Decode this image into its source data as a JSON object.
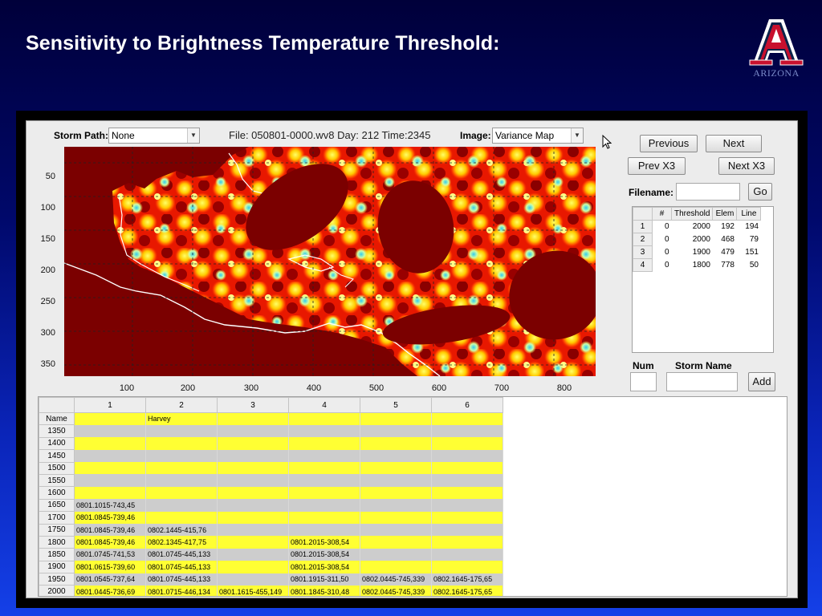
{
  "slide": {
    "title": "Sensitivity to Brightness Temperature Threshold:",
    "logo_text": "ARIZONA"
  },
  "toolbar": {
    "storm_path_label": "Storm Path:",
    "storm_path_value": "None",
    "file_info": "File: 050801-0000.wv8  Day: 212  Time:2345",
    "image_label": "Image:",
    "image_value": "Variance Map"
  },
  "nav": {
    "previous": "Previous",
    "next": "Next",
    "prev_x3": "Prev X3",
    "next_x3": "Next X3",
    "filename_label": "Filename:",
    "filename_value": "",
    "go": "Go"
  },
  "plot": {
    "y_ticks": [
      "50",
      "100",
      "150",
      "200",
      "250",
      "300",
      "350"
    ],
    "x_ticks": [
      "100",
      "200",
      "300",
      "400",
      "500",
      "600",
      "700",
      "800"
    ]
  },
  "threshold_table": {
    "headers": [
      "#",
      "Threshold",
      "Elem",
      "Line"
    ],
    "rows": [
      {
        "row": "1",
        "num": "0",
        "threshold": "2000",
        "elem": "192",
        "line": "194"
      },
      {
        "row": "2",
        "num": "0",
        "threshold": "2000",
        "elem": "468",
        "line": "79"
      },
      {
        "row": "3",
        "num": "0",
        "threshold": "1900",
        "elem": "479",
        "line": "151"
      },
      {
        "row": "4",
        "num": "0",
        "threshold": "1800",
        "elem": "778",
        "line": "50"
      }
    ]
  },
  "add_form": {
    "num_label": "Num",
    "storm_name_label": "Storm Name",
    "add": "Add"
  },
  "storm_grid": {
    "columns": [
      "1",
      "2",
      "3",
      "4",
      "5",
      "6"
    ],
    "rows": [
      {
        "label": "Name",
        "cells": [
          "",
          "Harvey",
          "",
          "",
          "",
          ""
        ]
      },
      {
        "label": "1350",
        "cells": [
          "",
          "",
          "",
          "",
          "",
          ""
        ]
      },
      {
        "label": "1400",
        "cells": [
          "",
          "",
          "",
          "",
          "",
          ""
        ]
      },
      {
        "label": "1450",
        "cells": [
          "",
          "",
          "",
          "",
          "",
          ""
        ]
      },
      {
        "label": "1500",
        "cells": [
          "",
          "",
          "",
          "",
          "",
          ""
        ]
      },
      {
        "label": "1550",
        "cells": [
          "",
          "",
          "",
          "",
          "",
          ""
        ]
      },
      {
        "label": "1600",
        "cells": [
          "",
          "",
          "",
          "",
          "",
          ""
        ]
      },
      {
        "label": "1650",
        "cells": [
          "0801.1015-743,45",
          "",
          "",
          "",
          "",
          ""
        ]
      },
      {
        "label": "1700",
        "cells": [
          "0801.0845-739,46",
          "",
          "",
          "",
          "",
          ""
        ]
      },
      {
        "label": "1750",
        "cells": [
          "0801.0845-739,46",
          "0802.1445-415,76",
          "",
          "",
          "",
          ""
        ]
      },
      {
        "label": "1800",
        "cells": [
          "0801.0845-739,46",
          "0802.1345-417,75",
          "",
          "0801.2015-308,54",
          "",
          ""
        ]
      },
      {
        "label": "1850",
        "cells": [
          "0801.0745-741,53",
          "0801.0745-445,133",
          "",
          "0801.2015-308,54",
          "",
          ""
        ]
      },
      {
        "label": "1900",
        "cells": [
          "0801.0615-739,60",
          "0801.0745-445,133",
          "",
          "0801.2015-308,54",
          "",
          ""
        ]
      },
      {
        "label": "1950",
        "cells": [
          "0801.0545-737,64",
          "0801.0745-445,133",
          "",
          "0801.1915-311,50",
          "0802.0445-745,339",
          "0802.1645-175,65"
        ]
      },
      {
        "label": "2000",
        "cells": [
          "0801.0445-736,69",
          "0801.0715-446,134",
          "0801.1615-455,149",
          "0801.1845-310,48",
          "0802.0445-745,339",
          "0802.1645-175,65"
        ]
      }
    ]
  },
  "colors": {
    "accent_blue": "#1440e8",
    "row_yellow": "#ffff33",
    "row_gray": "#cdcdcd",
    "map_dark_red": "#7b0000",
    "logo_red": "#c8102e",
    "logo_navy": "#0c234b"
  }
}
